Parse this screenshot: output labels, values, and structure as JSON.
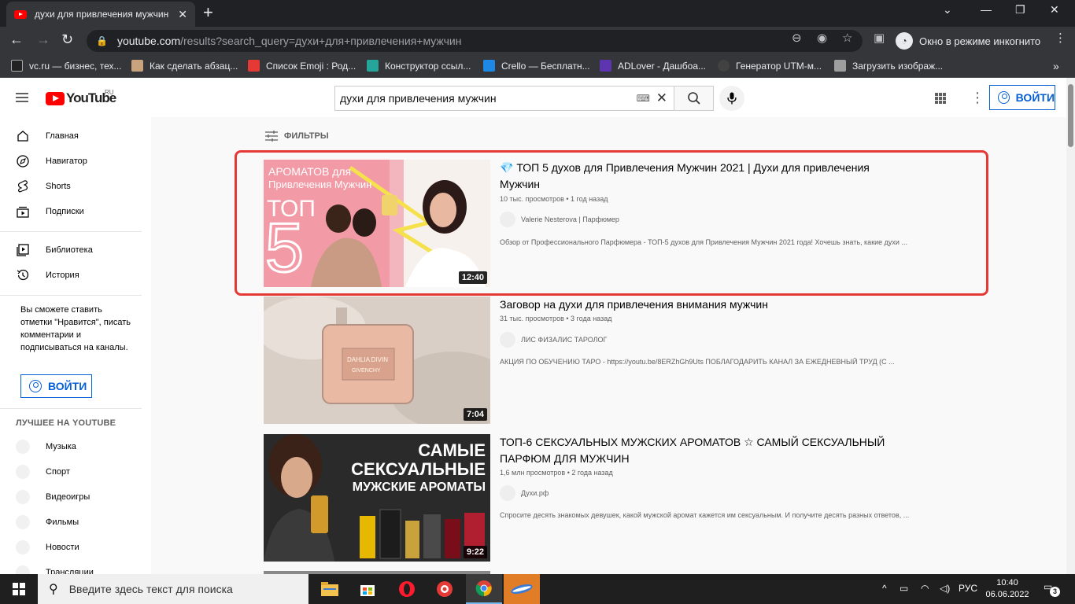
{
  "browser": {
    "tab_title": "духи для привлечения мужчин",
    "url_host": "youtube.com",
    "url_path": "/results?search_query=духи+для+привлечения+мужчин",
    "incognito_label": "Окно в режиме инкогнито",
    "bookmarks": [
      {
        "label": "vc.ru — бизнес, тех...",
        "color": "#222222"
      },
      {
        "label": "Как сделать абзац...",
        "color": "#c9a27e"
      },
      {
        "label": "Список Emoji : Род...",
        "color": "#e53935"
      },
      {
        "label": "Конструктор ссыл...",
        "color": "#26a69a"
      },
      {
        "label": "Crello — Бесплатн...",
        "color": "#1e88e5"
      },
      {
        "label": "ADLover - Дашбоа...",
        "color": "#5e35b1"
      },
      {
        "label": "Генератор UTM-м...",
        "color": "#424242"
      },
      {
        "label": "Загрузить изображ...",
        "color": "#9e9e9e"
      }
    ]
  },
  "youtube": {
    "logo_text": "YouTube",
    "logo_region": "RU",
    "search_value": "духи для привлечения мужчин",
    "signin_label": "ВОЙТИ",
    "sidebar": {
      "items": [
        {
          "label": "Главная",
          "icon": "⌂"
        },
        {
          "label": "Навигатор",
          "icon": "◎"
        },
        {
          "label": "Shorts",
          "icon": "∮"
        },
        {
          "label": "Подписки",
          "icon": "▤"
        }
      ],
      "items2": [
        {
          "label": "Библиотека",
          "icon": "▣"
        },
        {
          "label": "История",
          "icon": "↺"
        }
      ],
      "signin_note": "Вы сможете ставить отметки \"Нравится\", писать комментарии и подписываться на каналы.",
      "best_heading": "ЛУЧШЕЕ НА YOUTUBE",
      "best_items": [
        "Музыка",
        "Спорт",
        "Видеоигры",
        "Фильмы",
        "Новости",
        "Трансляции"
      ]
    },
    "filters_label": "ФИЛЬТРЫ",
    "videos": [
      {
        "title": "💎 ТОП 5 духов для Привлечения Мужчин 2021 | Духи для привлечения Мужчин",
        "meta": "10 тыс. просмотров • 1 год назад",
        "channel": "Valerie Nesterova | Парфюмер",
        "description": "Обзор от Профессионального Парфюмера - ТОП-5 духов для Привлечения Мужчин 2021 года! Хочешь знать, какие духи ...",
        "duration": "12:40",
        "thumb_text": {
          "line1": "АРОМАТОВ для",
          "line2": "Привлечения Мужчин",
          "line3": "ТОП",
          "line4": "5"
        }
      },
      {
        "title": "Заговор на духи для привлечения внимания мужчин",
        "meta": "31 тыс. просмотров • 3 года назад",
        "channel": "ЛИС ФИЗАЛИС ТАРОЛОГ",
        "description": "АКЦИЯ ПО ОБУЧЕНИЮ ТАРО - https://youtu.be/8ERZhGh9Uts ПОБЛАГОДАРИТЬ КАНАЛ ЗА ЕЖЕДНЕВНЫЙ ТРУД (С ...",
        "duration": "7:04",
        "thumb_text": {
          "line1": "DAHLIA DIVIN",
          "line2": "GIVENCHY"
        }
      },
      {
        "title": "ТОП-6 СЕКСУАЛЬНЫХ МУЖСКИХ АРОМАТОВ ☆ САМЫЙ СЕКСУАЛЬНЫЙ ПАРФЮМ ДЛЯ МУЖЧИН",
        "meta": "1,6 млн просмотров • 2 года назад",
        "channel": "Духи.рф",
        "description": "Спросите десять знакомых девушек, какой мужской аромат кажется им сексуальным. И получите десять разных ответов, ...",
        "duration": "9:22",
        "thumb_text": {
          "line1": "САМЫЕ",
          "line2": "СЕКСУАЛЬНЫЕ",
          "line3": "МУЖСКИЕ АРОМАТЫ"
        }
      }
    ]
  },
  "taskbar": {
    "search_placeholder": "Введите здесь текст для поиска",
    "language": "РУС",
    "time": "10:40",
    "date": "06.06.2022",
    "notifications": "3"
  }
}
